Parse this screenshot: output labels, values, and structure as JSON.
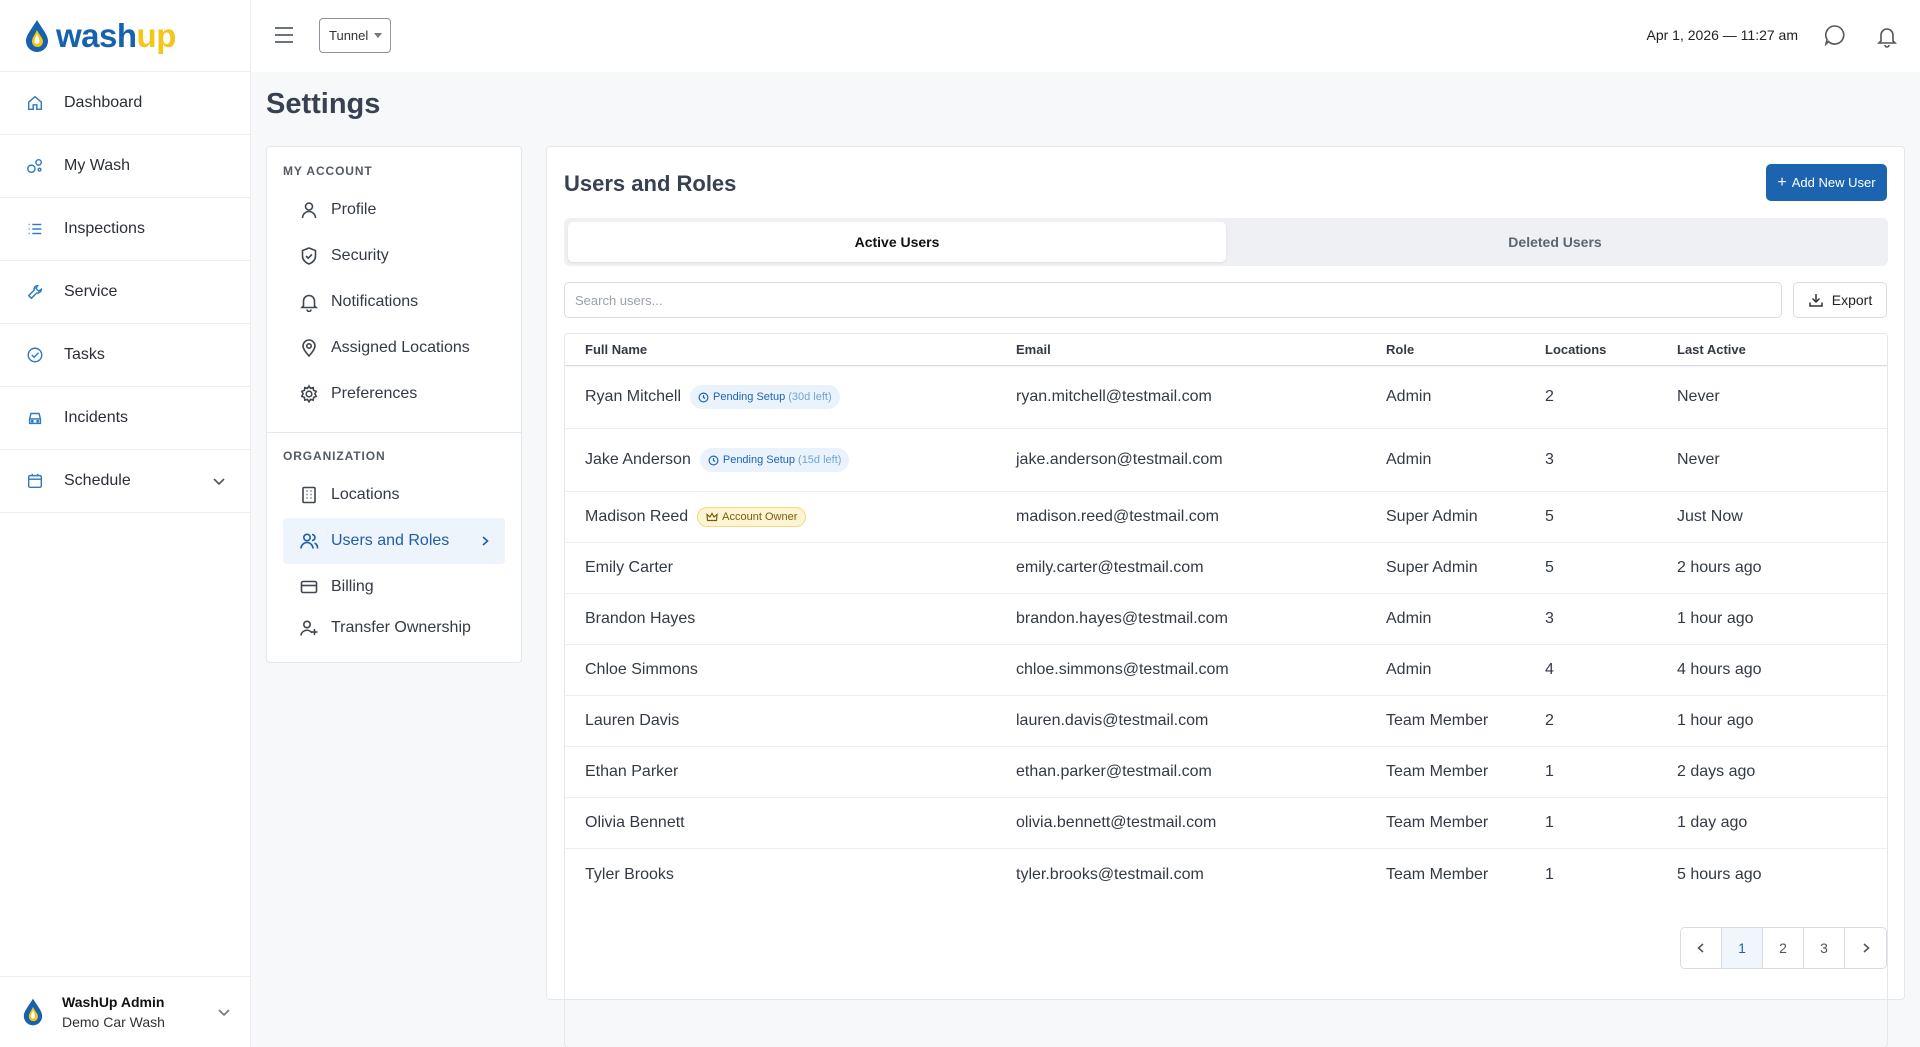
{
  "brand": {
    "part1": "wash",
    "part2": "up"
  },
  "sidebar": {
    "items": [
      {
        "label": "Dashboard",
        "icon": "home-icon"
      },
      {
        "label": "My Wash",
        "icon": "bubbles-icon"
      },
      {
        "label": "Inspections",
        "icon": "list-icon"
      },
      {
        "label": "Service",
        "icon": "wrench-icon"
      },
      {
        "label": "Tasks",
        "icon": "check-circle-icon"
      },
      {
        "label": "Incidents",
        "icon": "car-icon"
      },
      {
        "label": "Schedule",
        "icon": "calendar-icon"
      }
    ],
    "footer": {
      "name": "WashUp Admin",
      "sub": "Demo Car Wash"
    }
  },
  "topbar": {
    "tunnel": "Tunnel",
    "datetime": "Apr 1, 2026 — 11:27 am"
  },
  "page": {
    "title": "Settings"
  },
  "settings_menu": {
    "account_label": "MY ACCOUNT",
    "account_items": [
      "Profile",
      "Security",
      "Notifications",
      "Assigned Locations",
      "Preferences"
    ],
    "org_label": "ORGANIZATION",
    "org_items": [
      "Locations",
      "Users and Roles",
      "Billing",
      "Transfer Ownership"
    ]
  },
  "users": {
    "title": "Users and Roles",
    "add_button": "Add New User",
    "tabs": [
      "Active Users",
      "Deleted Users"
    ],
    "search_placeholder": "Search users...",
    "export_label": "Export",
    "columns": [
      "Full Name",
      "Email",
      "Role",
      "Locations",
      "Last Active"
    ],
    "rows": [
      {
        "name": "Ryan Mitchell",
        "badge": "Pending Setup",
        "badge_note": "(30d left)",
        "badge_type": "pending",
        "email": "ryan.mitchell@testmail.com",
        "role": "Admin",
        "locations": "2",
        "last": "Never"
      },
      {
        "name": "Jake Anderson",
        "badge": "Pending Setup",
        "badge_note": "(15d left)",
        "badge_type": "pending",
        "email": "jake.anderson@testmail.com",
        "role": "Admin",
        "locations": "3",
        "last": "Never"
      },
      {
        "name": "Madison Reed",
        "badge": "Account Owner",
        "badge_type": "owner",
        "email": "madison.reed@testmail.com",
        "role": "Super Admin",
        "locations": "5",
        "last": "Just Now"
      },
      {
        "name": "Emily Carter",
        "email": "emily.carter@testmail.com",
        "role": "Super Admin",
        "locations": "5",
        "last": "2 hours ago"
      },
      {
        "name": "Brandon Hayes",
        "email": "brandon.hayes@testmail.com",
        "role": "Admin",
        "locations": "3",
        "last": "1 hour ago"
      },
      {
        "name": "Chloe Simmons",
        "email": "chloe.simmons@testmail.com",
        "role": "Admin",
        "locations": "4",
        "last": "4 hours ago"
      },
      {
        "name": "Lauren Davis",
        "email": "lauren.davis@testmail.com",
        "role": "Team Member",
        "locations": "2",
        "last": "1 hour ago"
      },
      {
        "name": "Ethan Parker",
        "email": "ethan.parker@testmail.com",
        "role": "Team Member",
        "locations": "1",
        "last": "2 days ago"
      },
      {
        "name": "Olivia Bennett",
        "email": "olivia.bennett@testmail.com",
        "role": "Team Member",
        "locations": "1",
        "last": "1 day ago"
      },
      {
        "name": "Tyler Brooks",
        "email": "tyler.brooks@testmail.com",
        "role": "Team Member",
        "locations": "1",
        "last": "5 hours ago"
      }
    ],
    "pagination": {
      "pages": [
        "1",
        "2",
        "3"
      ],
      "current": "1"
    }
  },
  "colors": {
    "brand_blue": "#1c64b0",
    "brand_yellow": "#f5c518"
  }
}
